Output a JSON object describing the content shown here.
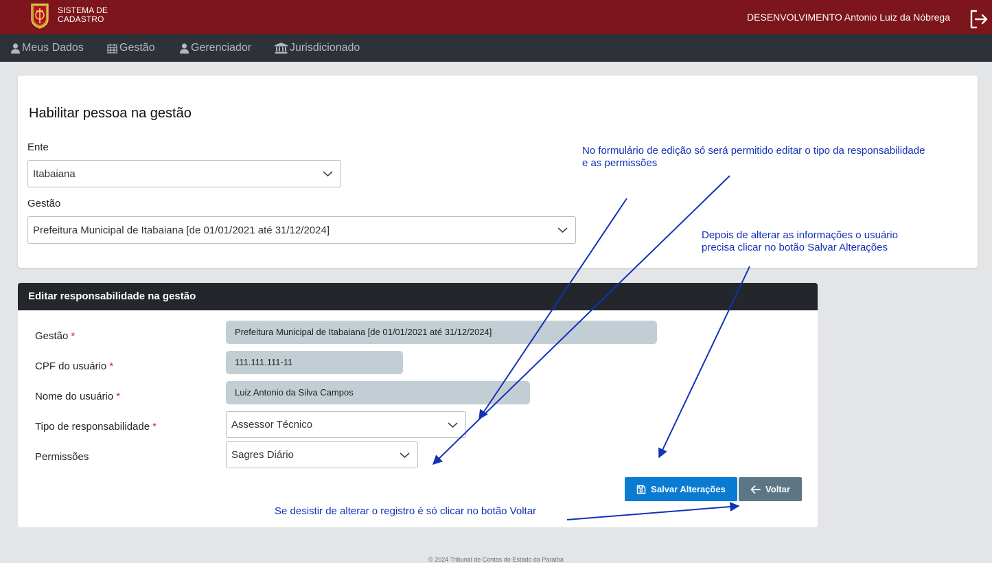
{
  "header": {
    "brand_line1": "SISTEMA DE",
    "brand_line2": "CADASTRO",
    "user": "DESENVOLVIMENTO Antonio Luiz da Nóbrega",
    "bg_color": "#7c161c"
  },
  "nav": {
    "items": [
      {
        "label": "Meus Dados",
        "icon": "user-icon"
      },
      {
        "label": "Gestão",
        "icon": "calendar-icon"
      },
      {
        "label": "Gerenciador",
        "icon": "user-icon"
      },
      {
        "label": "Jurisdicionado",
        "icon": "institution-icon"
      }
    ]
  },
  "habilitar": {
    "title": "Habilitar pessoa na gestão",
    "ente_label": "Ente",
    "ente_value": "Itabaiana",
    "gestao_label": "Gestão",
    "gestao_value": "Prefeitura Municipal de Itabaiana [de 01/01/2021 até 31/12/2024]"
  },
  "editar": {
    "header": "Editar responsabilidade na gestão",
    "gestao_label": "Gestão",
    "gestao_value": "Prefeitura Municipal de Itabaiana [de 01/01/2021 até 31/12/2024]",
    "cpf_label": "CPF do usuário",
    "cpf_value": "111.111.111-11",
    "nome_label": "Nome do usuário",
    "nome_value": "Luiz Antonio da Silva Campos",
    "tipo_label": "Tipo de responsabilidade",
    "tipo_value": "Assessor Técnico",
    "permissoes_label": "Permissões",
    "permissoes_value": "Sagres Diário",
    "required_mark": "*",
    "save_label": "Salvar Alterações",
    "back_label": "Voltar"
  },
  "annotations": {
    "note1_line1": "No formulário de edição só será permitido editar o tipo da responsabilidade",
    "note1_line2": "e as permissões",
    "note2_line1": "Depois de alterar as informações o usuário",
    "note2_line2": "precisa clicar no botão Salvar Alterações",
    "note3": "Se desistir de alterar o registro é só clicar no botão Voltar",
    "color": "#1231b8"
  },
  "footer": "© 2024 Tribunal de Contas do Estado da Paraíba"
}
